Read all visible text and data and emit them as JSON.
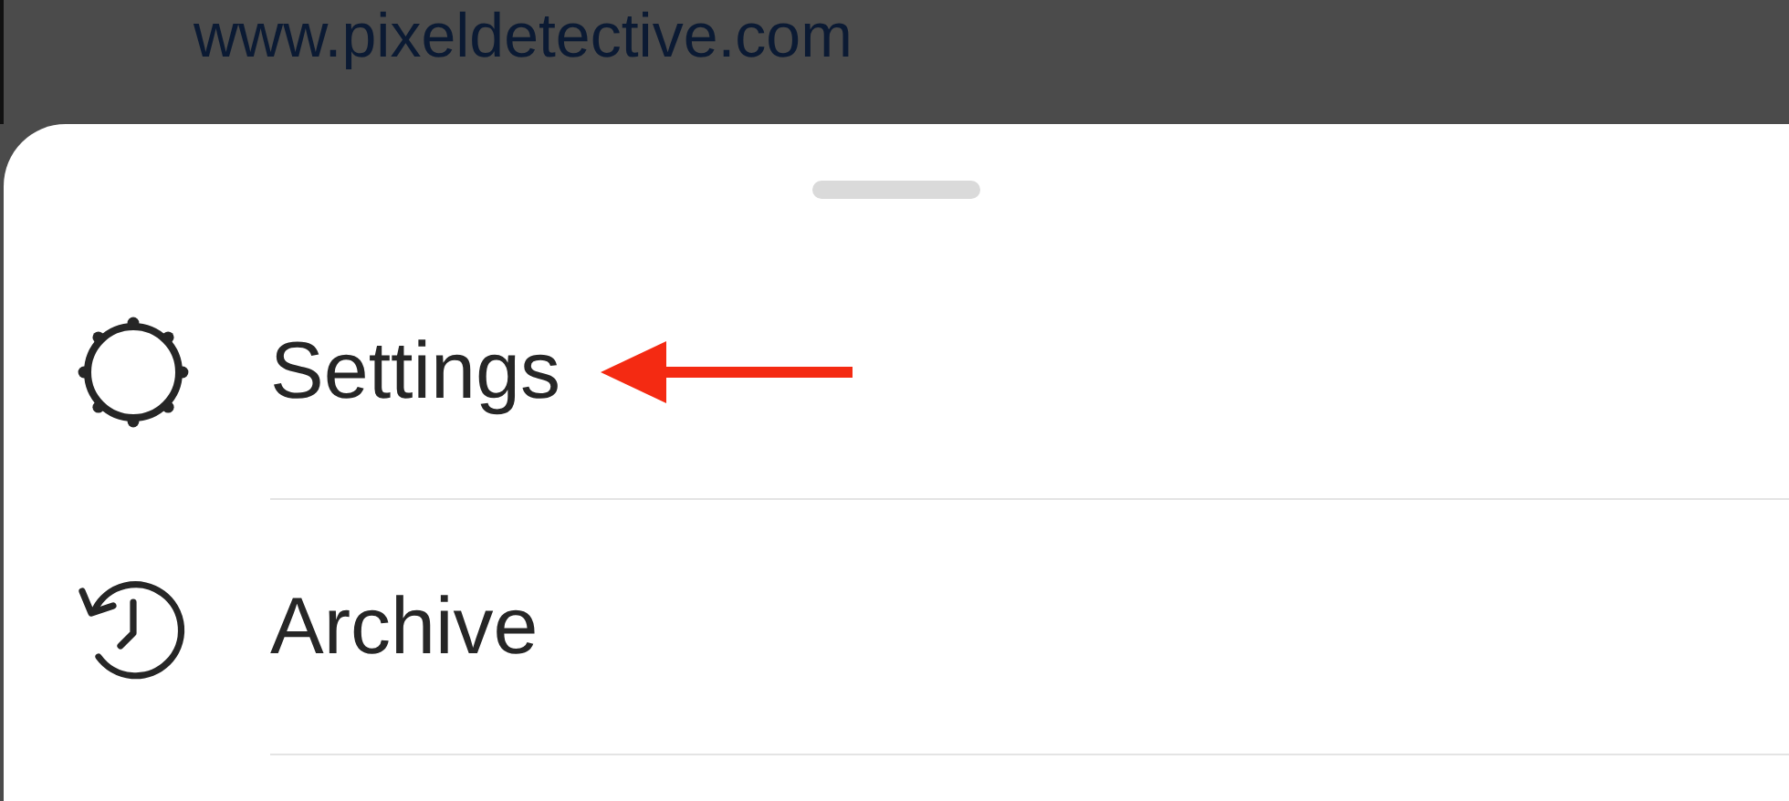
{
  "background": {
    "url": "www.pixeldetective.com"
  },
  "sheet": {
    "items": [
      {
        "kind": "settings",
        "label": "Settings",
        "pointed": true
      },
      {
        "kind": "archive",
        "label": "Archive",
        "pointed": false
      }
    ]
  }
}
